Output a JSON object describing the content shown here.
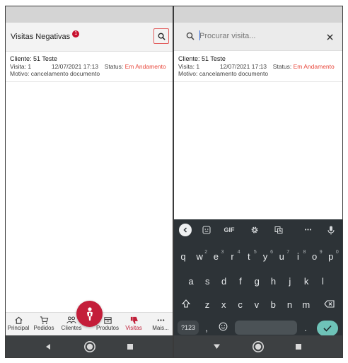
{
  "left_screen": {
    "header": {
      "title": "Visitas Negativas",
      "badge": "1"
    },
    "visit": {
      "client": "Cliente: 51 Teste",
      "visit_num": "Visita: 1",
      "datetime": "12/07/2021 17:13",
      "status_label": "Status:",
      "status_value": "Em Andamento",
      "reason": "Motivo: cancelamento documento"
    },
    "nav": [
      {
        "label": "Principal",
        "icon": "home-icon"
      },
      {
        "label": "Pedidos",
        "icon": "cart-icon"
      },
      {
        "label": "Clientes",
        "icon": "people-icon"
      },
      {
        "label": "Produtos",
        "icon": "box-icon"
      },
      {
        "label": "Visitas",
        "icon": "thumbs-down-icon",
        "active": true
      },
      {
        "label": "Mais...",
        "icon": "more-icon"
      }
    ]
  },
  "right_screen": {
    "search": {
      "placeholder": "Procurar visita...",
      "value": ""
    },
    "visit": {
      "client": "Cliente: 51 Teste",
      "visit_num": "Visita: 1",
      "datetime": "12/07/2021 17:13",
      "status_label": "Status:",
      "status_value": "Em Andamento",
      "reason": "Motivo: cancelamento documento"
    },
    "keyboard": {
      "toolbar": [
        "back-arrow-icon",
        "sticker-icon",
        "GIF",
        "settings-icon",
        "translate-icon",
        "more-horizontal-icon",
        "mic-icon"
      ],
      "gif_label": "GIF",
      "more_label": "•••",
      "row1": [
        {
          "k": "q",
          "h": ""
        },
        {
          "k": "w",
          "h": "2"
        },
        {
          "k": "e",
          "h": "3"
        },
        {
          "k": "r",
          "h": "4"
        },
        {
          "k": "t",
          "h": "5"
        },
        {
          "k": "y",
          "h": "6"
        },
        {
          "k": "u",
          "h": "7"
        },
        {
          "k": "i",
          "h": "8"
        },
        {
          "k": "o",
          "h": "9"
        },
        {
          "k": "p",
          "h": "0"
        }
      ],
      "row2": [
        "a",
        "s",
        "d",
        "f",
        "g",
        "h",
        "j",
        "k",
        "l"
      ],
      "row3": [
        "z",
        "x",
        "c",
        "v",
        "b",
        "n",
        "m"
      ],
      "key123": "?123",
      "comma": ",",
      "period": "."
    }
  },
  "colors": {
    "accent_red": "#c41e3a",
    "status_red": "#e8483c",
    "keyboard_bg": "#2d3337",
    "enter_teal": "#6ec3b8",
    "sysnav_bg": "#3d4042"
  }
}
